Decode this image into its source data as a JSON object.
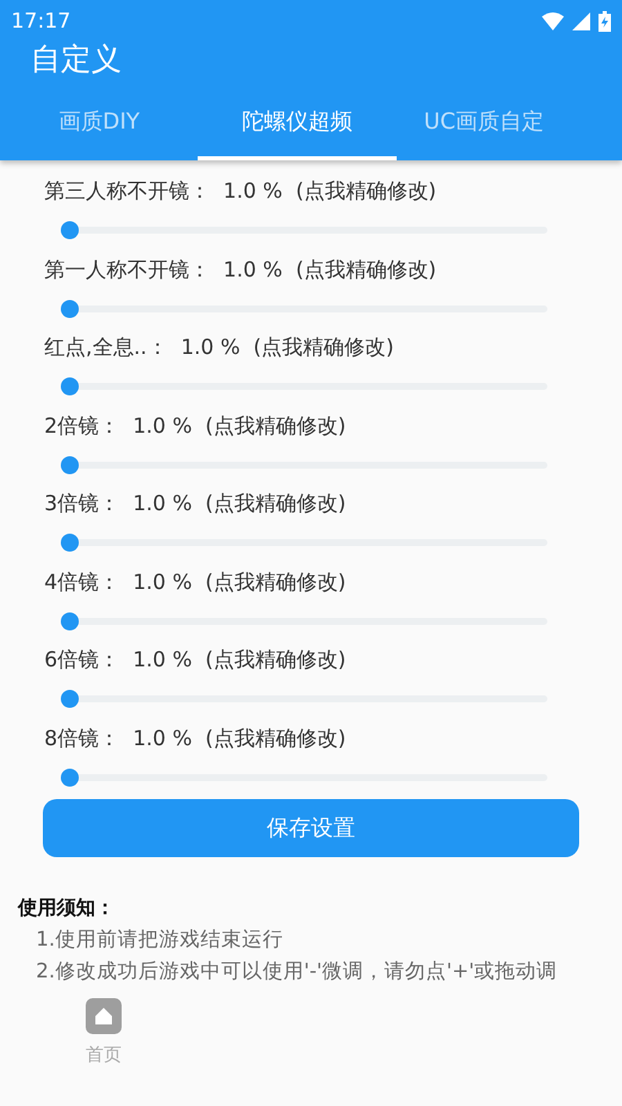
{
  "status_bar": {
    "time": "17:17"
  },
  "app_bar": {
    "title": "自定义"
  },
  "tabs": [
    {
      "label": "画质DIY",
      "selected": false
    },
    {
      "label": "陀螺仪超频",
      "selected": true
    },
    {
      "label": "UC画质自定",
      "selected": false
    }
  ],
  "sliders": [
    {
      "label": "第三人称不开镜：",
      "reading": "1.0 %",
      "hint": "(点我精确修改)",
      "level": 0.01
    },
    {
      "label": "第一人称不开镜：",
      "reading": "1.0 %",
      "hint": "(点我精确修改)",
      "level": 0.01
    },
    {
      "label": "红点,全息..：",
      "reading": "1.0 %",
      "hint": "(点我精确修改)",
      "level": 0.01
    },
    {
      "label": "2倍镜：",
      "reading": "1.0 %",
      "hint": "(点我精确修改)",
      "level": 0.01
    },
    {
      "label": "3倍镜：",
      "reading": "1.0 %",
      "hint": "(点我精确修改)",
      "level": 0.01
    },
    {
      "label": "4倍镜：",
      "reading": "1.0 %",
      "hint": "(点我精确修改)",
      "level": 0.01
    },
    {
      "label": "6倍镜：",
      "reading": "1.0 %",
      "hint": "(点我精确修改)",
      "level": 0.01
    },
    {
      "label": "8倍镜：",
      "reading": "1.0 %",
      "hint": "(点我精确修改)",
      "level": 0.01
    }
  ],
  "save_button": "保存设置",
  "notice": {
    "title": "使用须知：",
    "lines": [
      "1.使用前请把游戏结束运行",
      "2.修改成功后游戏中可以使用'-'微调，请勿点'+'或拖动调"
    ]
  },
  "bottom_nav": [
    {
      "label": "首页",
      "selected": false
    }
  ]
}
